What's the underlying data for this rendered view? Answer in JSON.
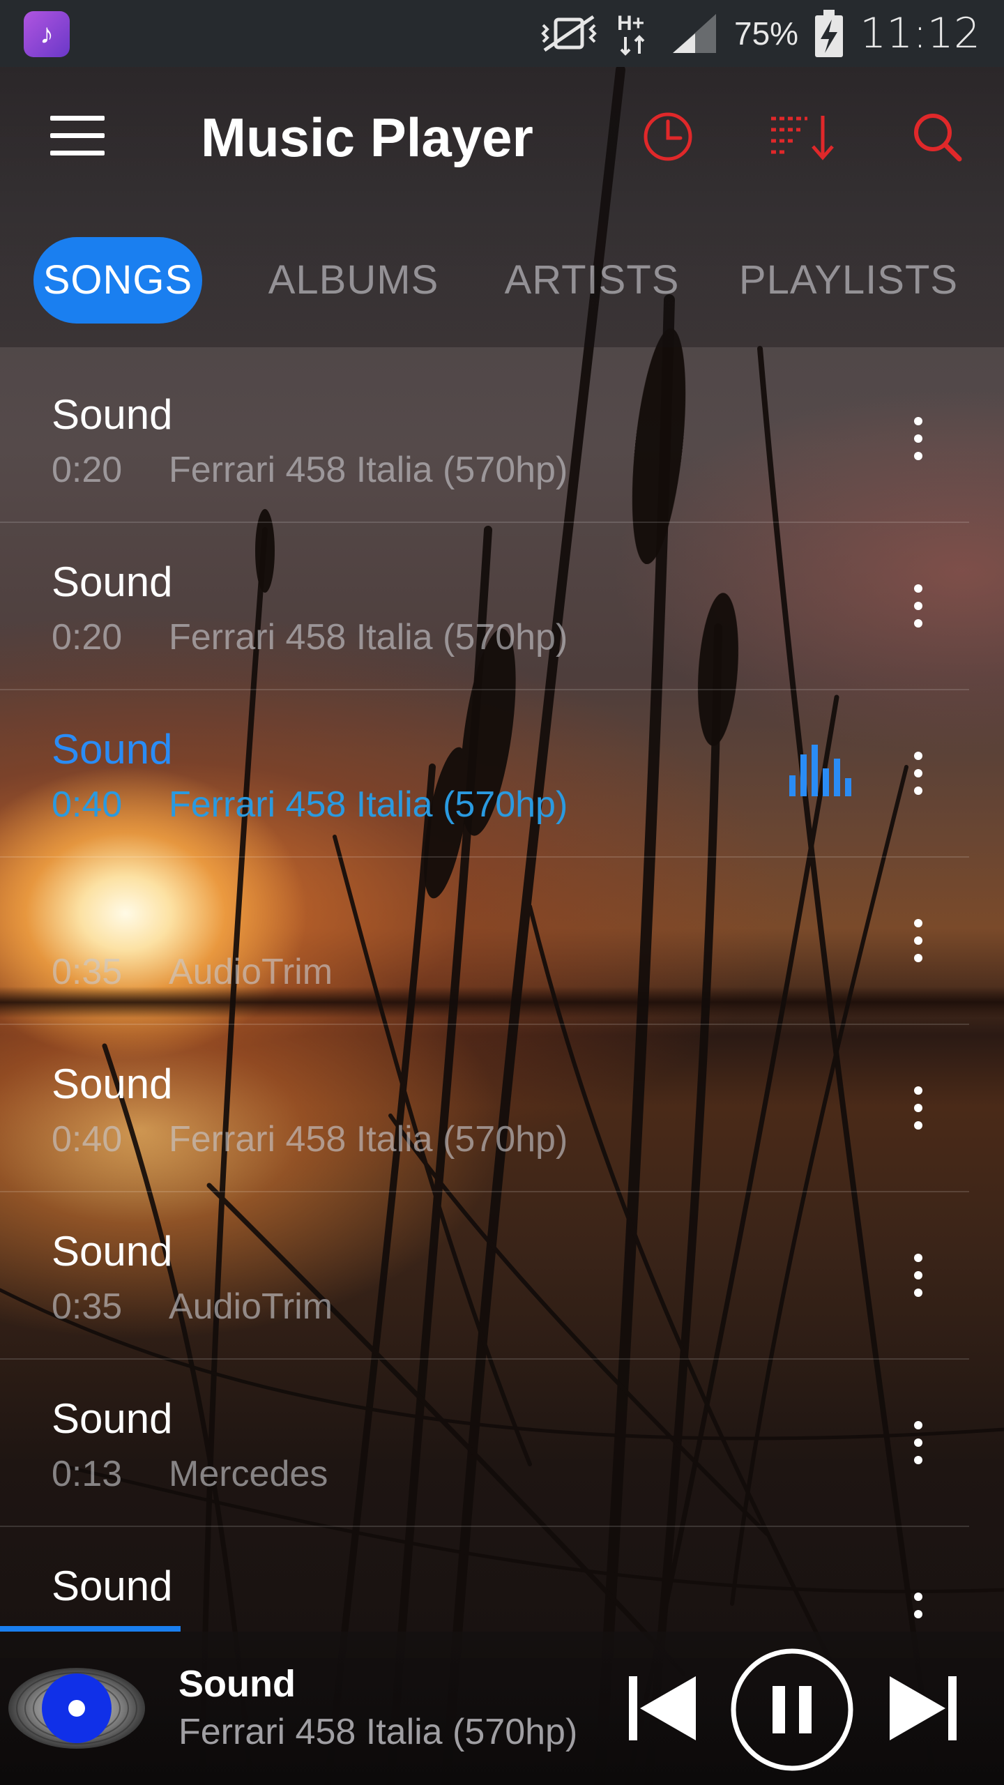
{
  "status_bar": {
    "app_icon": "music-note-icon",
    "network": "H+",
    "battery_percent": "75%",
    "time": "11:12"
  },
  "app_bar": {
    "title": "Music Player",
    "icons": [
      "menu-icon",
      "sleep-timer-icon",
      "sort-icon",
      "search-icon"
    ]
  },
  "tabs": [
    {
      "label": "SONGS",
      "active": true
    },
    {
      "label": "ALBUMS",
      "active": false
    },
    {
      "label": "ARTISTS",
      "active": false
    },
    {
      "label": "PLAYLISTS",
      "active": false
    }
  ],
  "songs": [
    {
      "title": "Sound",
      "duration": "0:20",
      "artist": "Ferrari 458 Italia (570hp)",
      "playing": false
    },
    {
      "title": "Sound",
      "duration": "0:20",
      "artist": "Ferrari 458 Italia (570hp)",
      "playing": false
    },
    {
      "title": "Sound",
      "duration": "0:40",
      "artist": "Ferrari 458 Italia (570hp)",
      "playing": true
    },
    {
      "title": "",
      "duration": "0:35",
      "artist": "AudioTrim",
      "playing": false
    },
    {
      "title": "Sound",
      "duration": "0:40",
      "artist": "Ferrari 458 Italia (570hp)",
      "playing": false
    },
    {
      "title": "Sound",
      "duration": "0:35",
      "artist": "AudioTrim",
      "playing": false
    },
    {
      "title": "Sound",
      "duration": "0:13",
      "artist": "Mercedes",
      "playing": false
    },
    {
      "title": "Sound",
      "duration": "",
      "artist": "",
      "playing": false
    }
  ],
  "now_playing": {
    "title": "Sound",
    "artist": "Ferrari 458 Italia (570hp)",
    "progress_fraction": 0.18,
    "controls": [
      "previous-icon",
      "pause-icon",
      "next-icon"
    ]
  },
  "colors": {
    "accent": "#1a7ff0",
    "header_icons": "#e0282a",
    "playing_text": "#2a8cf5"
  }
}
